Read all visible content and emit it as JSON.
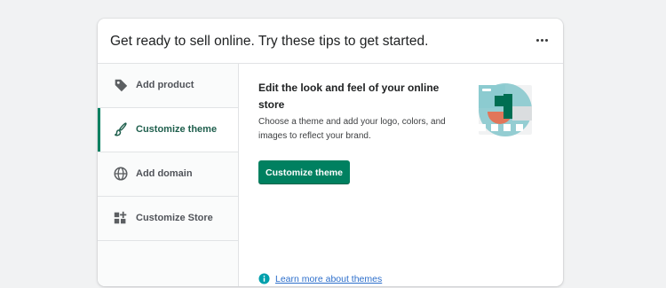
{
  "card": {
    "title": "Get ready to sell online. Try these tips to get started.",
    "more_icon": "horizontal-dots-icon"
  },
  "tabs": [
    {
      "label": "Add product",
      "icon": "tag-icon",
      "active": false
    },
    {
      "label": "Customize theme",
      "icon": "paintbrush-icon",
      "active": true
    },
    {
      "label": "Add domain",
      "icon": "globe-icon",
      "active": false
    },
    {
      "label": "Customize Store",
      "icon": "apps-grid-icon",
      "active": false
    }
  ],
  "panel": {
    "heading": "Edit the look and feel of your online store",
    "description": "Choose a theme and add your logo, colors, and images to reflect your brand.",
    "button_label": "Customize theme",
    "learn_more": "Learn more about themes",
    "illustration": "theme-illustration"
  },
  "colors": {
    "accent": "#008060",
    "active_tab_text": "#1f5f4d",
    "link": "#2c6ecb",
    "info_icon": "#00a0ac"
  }
}
